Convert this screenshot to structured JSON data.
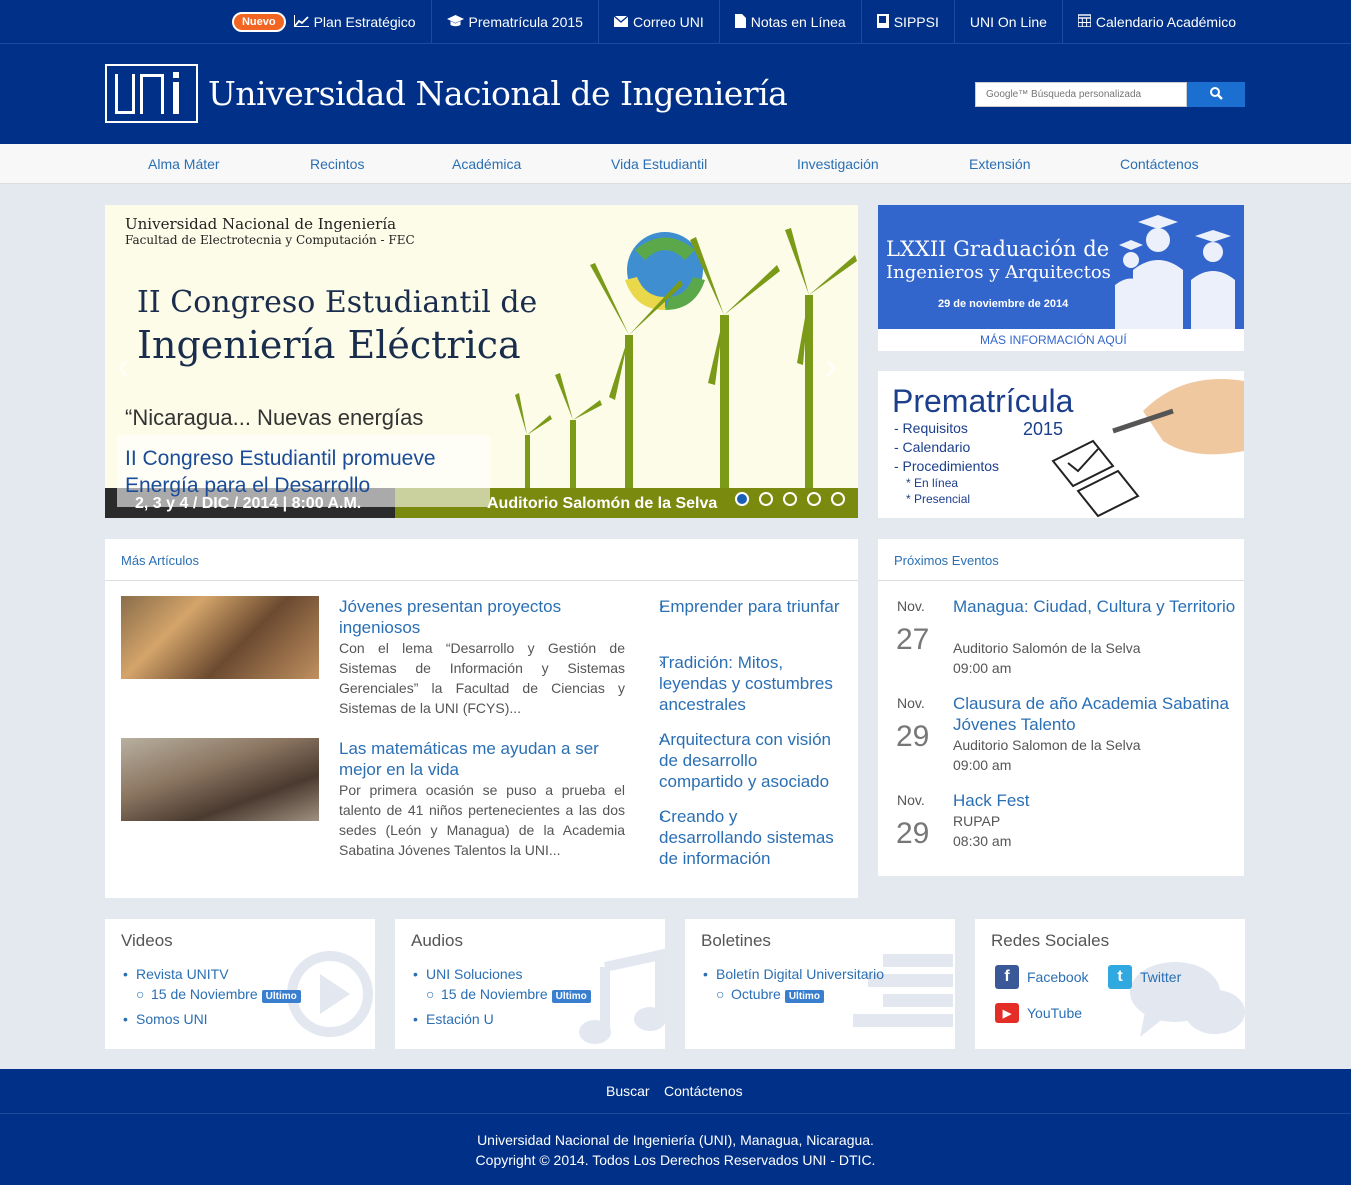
{
  "topbar": {
    "new_badge": "Nuevo",
    "links": [
      {
        "label": "Plan Estratégico",
        "icon": "chart-line-icon"
      },
      {
        "label": "Prematrícula 2015",
        "icon": "graduation-cap-icon"
      },
      {
        "label": "Correo UNI",
        "icon": "envelope-icon"
      },
      {
        "label": "Notas en Línea",
        "icon": "file-icon"
      },
      {
        "label": "SIPPSI",
        "icon": "book-icon"
      },
      {
        "label": "UNI On Line",
        "icon": ""
      },
      {
        "label": "Calendario Académico",
        "icon": "calendar-icon"
      }
    ]
  },
  "header": {
    "title": "Universidad Nacional de Ingeniería",
    "search_placeholder": "Google™ Búsqueda personalizada"
  },
  "nav": [
    "Alma Máter",
    "Recintos",
    "Académica",
    "Vida Estudiantil",
    "Investigación",
    "Extensión",
    "Contáctenos"
  ],
  "slider": {
    "univ": "Universidad Nacional de Ingeniería",
    "fac": "Facultad de Electrotecnia y Computación - FEC",
    "headline1": "II Congreso Estudiantil de",
    "headline2": "Ingeniería Eléctrica",
    "quote": "“Nicaragua... Nuevas energías",
    "caption": "II Congreso Estudiantil promueve Energía para el Desarrollo",
    "date": "2, 3 y 4 / DIC / 2014  |  8:00 A.M.",
    "venue": "Auditorio Salomón de la Selva"
  },
  "banners": {
    "grad_title1": "LXXII Graduación de",
    "grad_title2": "Ingenieros y Arquitectos",
    "grad_date": "29 de noviembre de 2014",
    "grad_more": "MÁS INFORMACIÓN AQUÍ",
    "prem_title": "Prematrícula",
    "prem_year": "2015",
    "prem_items": [
      "- Requisitos",
      "- Calendario",
      "- Procedimientos"
    ],
    "prem_sub": [
      "* En línea",
      "* Presencial"
    ]
  },
  "articles": {
    "header": "Más Artículos",
    "items": [
      {
        "title": "Jóvenes presentan proyectos ingeniosos",
        "text": "Con el lema “Desarrollo y Gestión de Sistemas de Información y Sistemas Gerenciales” la Facultad de Ciencias y Sistemas de la UNI (FCYS)..."
      },
      {
        "title": "Las matemáticas me ayudan a ser mejor en la vida",
        "text": "Por primera ocasión se puso a prueba el talento de 41 niños pertenecientes a las dos sedes (León y Managua) de la Academia Sabatina Jóvenes Talentos la UNI..."
      }
    ],
    "side_links": [
      "Emprender para triunfar",
      "Tradición: Mitos, leyendas y costumbres ancestrales",
      "Arquitectura con visión de desarrollo compartido y asociado",
      "Creando y desarrollando sistemas de información"
    ]
  },
  "events": {
    "header": "Próximos Eventos",
    "items": [
      {
        "month": "Nov.",
        "day": "27",
        "title": "Managua: Ciudad, Cultura y Territorio",
        "location": "Auditorio Salomón de la Selva",
        "time": "09:00 am"
      },
      {
        "month": "Nov.",
        "day": "29",
        "title": "Clausura de año Academia Sabatina Jóvenes Talento",
        "location": "Auditorio Salomon de la Selva",
        "time": "09:00 am"
      },
      {
        "month": "Nov.",
        "day": "29",
        "title": "Hack Fest",
        "location": "RUPAP",
        "time": "08:30 am"
      }
    ]
  },
  "boxes": {
    "videos": {
      "title": "Videos",
      "item1": "Revista UNITV",
      "sub1": "15 de Noviembre",
      "tag": "Ultimo",
      "item2": "Somos UNI"
    },
    "audios": {
      "title": "Audios",
      "item1": "UNI Soluciones",
      "sub1": "15 de Noviembre",
      "tag": "Ultimo",
      "item2": "Estación U"
    },
    "boletines": {
      "title": "Boletines",
      "item1": "Boletín Digital Universitario",
      "sub1": "Octubre",
      "tag": "Ultimo"
    },
    "social": {
      "title": "Redes Sociales",
      "facebook": "Facebook",
      "twitter": "Twitter",
      "youtube": "YouTube"
    }
  },
  "footer": {
    "links": [
      "Buscar",
      "Contáctenos"
    ],
    "line1": "Universidad Nacional de Ingeniería (UNI), Managua, Nicaragua.",
    "line2": "Copyright © 2014. Todos Los Derechos Reservados UNI - DTIC."
  }
}
